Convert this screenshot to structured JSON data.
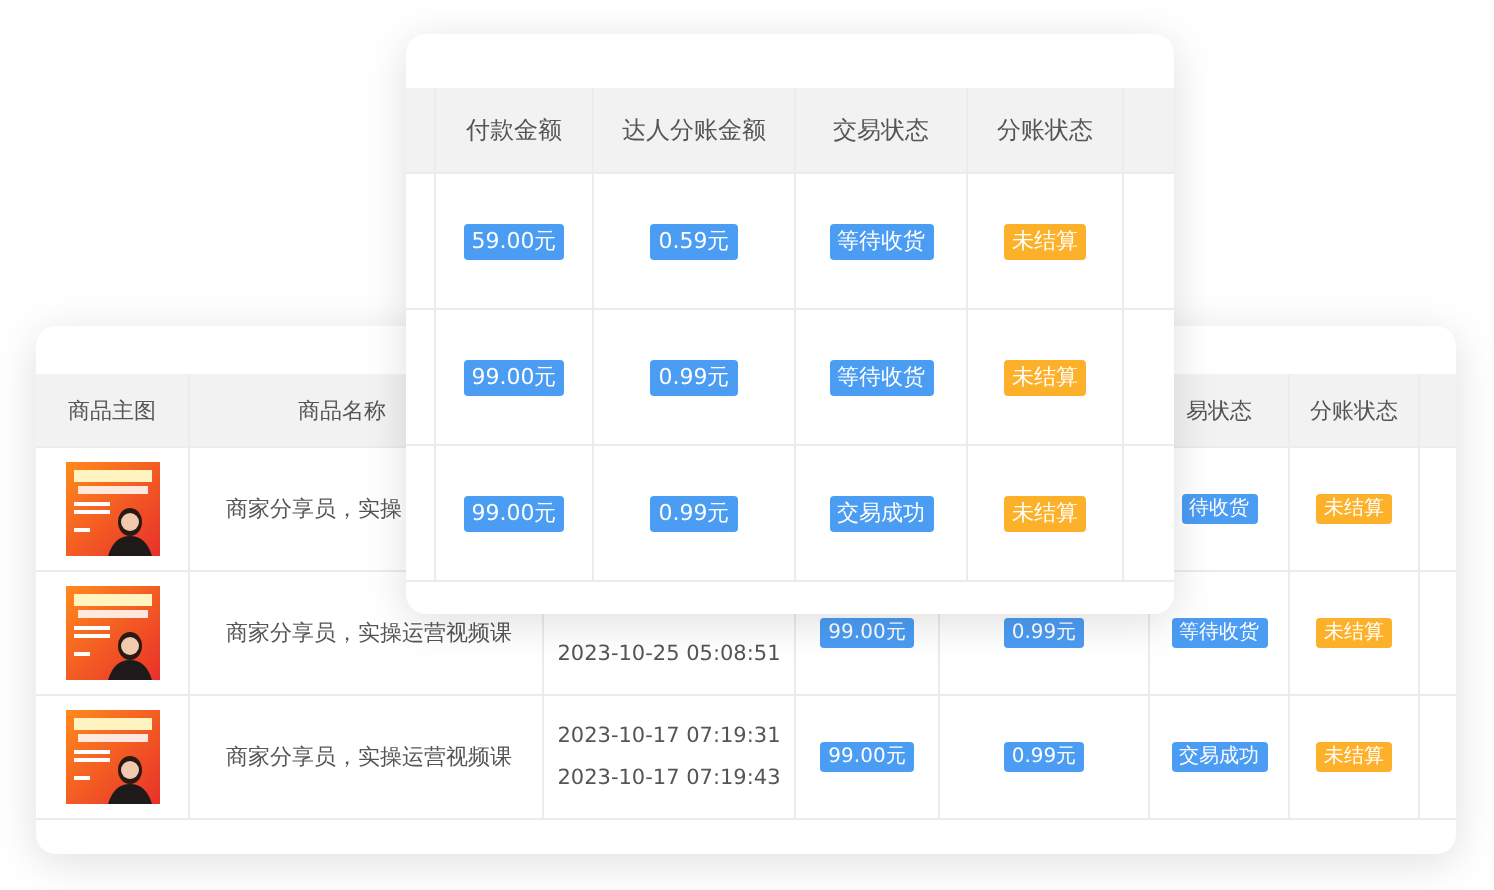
{
  "back_table": {
    "header": {
      "image": "商品主图",
      "name": "商品名称",
      "trade_status": "易状态",
      "split_status": "分账状态"
    },
    "rows": [
      {
        "kind": "picture",
        "name": "商家分享员，实操",
        "trade_status": "待收货",
        "split_status": "未结算"
      },
      {
        "kind": "picture",
        "name": "商家分享员，实操运营视频课",
        "times": [
          "2023-10-25 05:08:51"
        ],
        "payment": "99.00元",
        "share": "0.99元",
        "trade_status": "等待收货",
        "split_status": "未结算"
      },
      {
        "kind": "picture",
        "name": "商家分享员，实操运营视频课",
        "times": [
          "2023-10-17 07:19:31",
          "2023-10-17 07:19:43"
        ],
        "payment": "99.00元",
        "share": "0.99元",
        "trade_status": "交易成功",
        "split_status": "未结算"
      }
    ]
  },
  "front_table": {
    "header": {
      "payment": "付款金额",
      "share": "达人分账金额",
      "trade_status": "交易状态",
      "split_status": "分账状态"
    },
    "rows": [
      {
        "payment": "59.00元",
        "share": "0.59元",
        "trade_status": "等待收货",
        "split_status": "未结算"
      },
      {
        "payment": "99.00元",
        "share": "0.99元",
        "trade_status": "等待收货",
        "split_status": "未结算"
      },
      {
        "payment": "99.00元",
        "share": "0.99元",
        "trade_status": "交易成功",
        "split_status": "未结算"
      }
    ]
  }
}
